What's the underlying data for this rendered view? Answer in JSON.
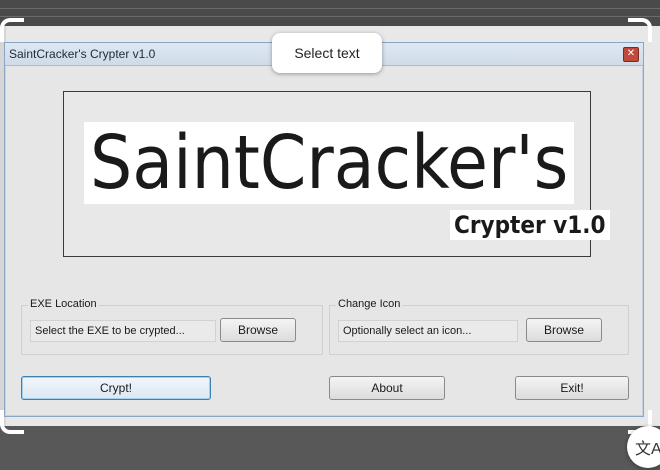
{
  "window": {
    "title": "SaintCracker's Crypter v1.0",
    "close_glyph": "✕"
  },
  "logo": {
    "main": "SaintCracker's",
    "sub": "Crypter v1.0"
  },
  "exe_group": {
    "legend": "EXE Location",
    "field_value": "Select the EXE to be crypted...",
    "browse_label": "Browse"
  },
  "icon_group": {
    "legend": "Change Icon",
    "field_value": "Optionally select an icon...",
    "browse_label": "Browse"
  },
  "actions": {
    "crypt_label": "Crypt!",
    "about_label": "About",
    "exit_label": "Exit!"
  },
  "overlay": {
    "tooltip": "Select text",
    "translate_icon": "translate-icon",
    "translate_glyph": "文A"
  },
  "colors": {
    "titlebar": "#cfdbe8",
    "primary_border": "#3c7fb1",
    "close": "#c24a3a"
  }
}
